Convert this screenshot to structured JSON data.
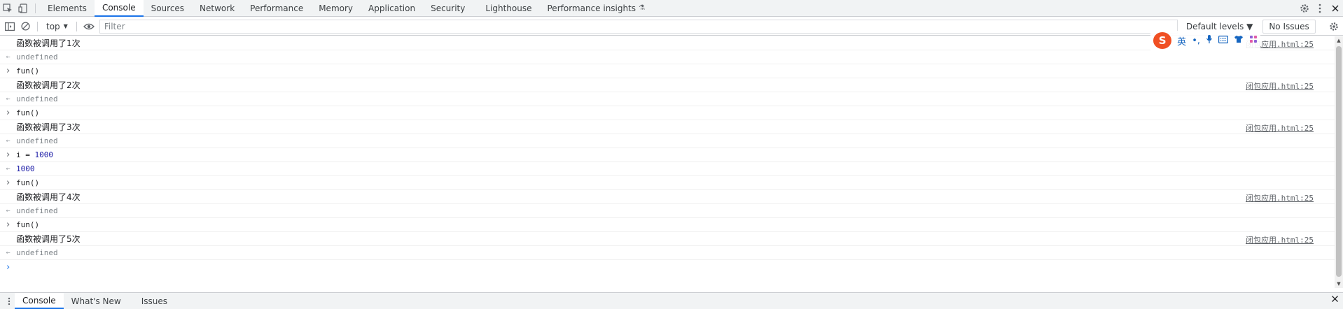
{
  "toolbar": {
    "tabs": [
      "Elements",
      "Console",
      "Sources",
      "Network",
      "Performance",
      "Memory",
      "Application",
      "Security",
      "Lighthouse",
      "Performance insights"
    ],
    "active_tab": "Console",
    "performance_insights_badge": "⚗"
  },
  "filterbar": {
    "context": "top",
    "filter_placeholder": "Filter",
    "levels": "Default levels ▼",
    "issues": "No Issues"
  },
  "console": {
    "rows": [
      {
        "type": "log",
        "text": "函数被调用了1次",
        "source": "闭包应用.html:25"
      },
      {
        "type": "result",
        "text": "undefined"
      },
      {
        "type": "input",
        "text": "fun()"
      },
      {
        "type": "log",
        "text": "函数被调用了2次",
        "source": "闭包应用.html:25"
      },
      {
        "type": "result",
        "text": "undefined"
      },
      {
        "type": "input",
        "text": "fun()"
      },
      {
        "type": "log",
        "text": "函数被调用了3次",
        "source": "闭包应用.html:25"
      },
      {
        "type": "result",
        "text": "undefined"
      },
      {
        "type": "input",
        "text": "i = 1000"
      },
      {
        "type": "result-num",
        "text": "1000"
      },
      {
        "type": "input",
        "text": "fun()"
      },
      {
        "type": "log",
        "text": "函数被调用了4次",
        "source": "闭包应用.html:25"
      },
      {
        "type": "result",
        "text": "undefined"
      },
      {
        "type": "input",
        "text": "fun()"
      },
      {
        "type": "log",
        "text": "函数被调用了5次",
        "source": "闭包应用.html:25"
      },
      {
        "type": "result",
        "text": "undefined"
      },
      {
        "type": "prompt",
        "text": ""
      }
    ]
  },
  "ime": {
    "logo": "S",
    "mode": "英",
    "punct": "•,",
    "mic": "🎤",
    "keyboard": "⌨",
    "skin": "👕",
    "apps": "⊞"
  },
  "drawer": {
    "tabs": [
      "Console",
      "What's New",
      "Issues"
    ],
    "active_tab": "Console"
  }
}
